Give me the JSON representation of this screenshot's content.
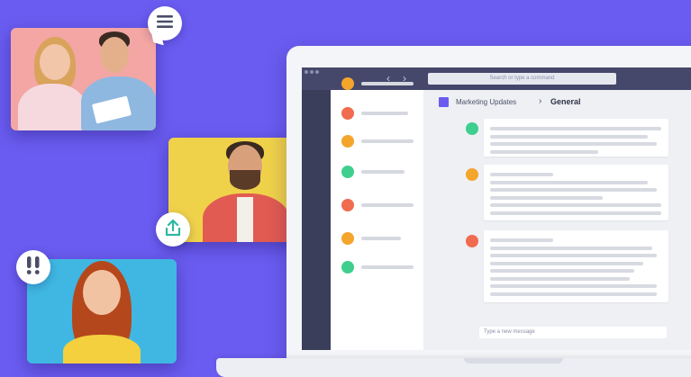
{
  "window": {
    "search_placeholder": "Search or type a command",
    "nav_back_icon": "chevron-left-icon",
    "nav_forward_icon": "chevron-right-icon"
  },
  "header": {
    "team_name": "Marketing Updates",
    "separator_icon": "chevron-right-icon",
    "channel_name": "General"
  },
  "channels": [
    {
      "status_color": "#3ecf8e"
    },
    {
      "status_color": "#f4a52c"
    },
    {
      "status_color": "#f06b4f"
    },
    {
      "status_color": "#f4a52c"
    },
    {
      "status_color": "#3ecf8e"
    },
    {
      "status_color": "#f06b4f"
    },
    {
      "status_color": "#f4a52c"
    },
    {
      "status_color": "#3ecf8e"
    }
  ],
  "messages": [
    {
      "avatar_color": "#3ecf8e"
    },
    {
      "avatar_color": "#f4a52c"
    },
    {
      "avatar_color": "#f06b4f"
    }
  ],
  "composer": {
    "placeholder": "Type a new message"
  },
  "badges": {
    "chat": "menu-lines-icon",
    "share": "upload-share-icon",
    "alert": "double-exclamation-icon"
  },
  "colors": {
    "background": "#6a5cf0",
    "titlebar": "#45486b",
    "rail": "#3b3e5a",
    "accent": "#6a5cf0",
    "teal_icon": "#2eb8a0",
    "alert_icon": "#4a4d66"
  }
}
